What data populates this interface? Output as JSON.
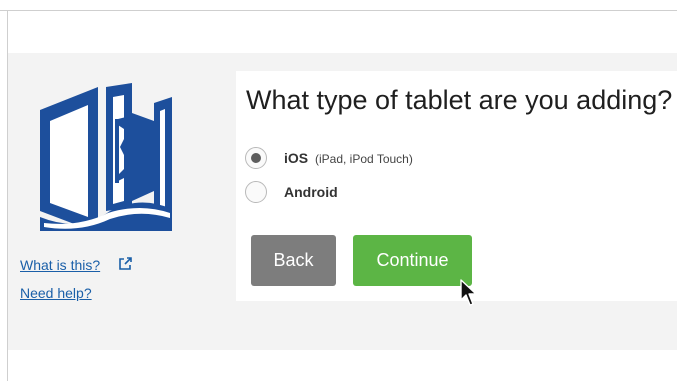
{
  "sidebar": {
    "logo_icon": "open-book-b-logo",
    "what_is_this": "What is this?",
    "need_help": "Need help?",
    "external_icon": "external-link-icon"
  },
  "card": {
    "question": "What type of tablet are you adding?",
    "options": [
      {
        "label": "iOS",
        "detail": "(iPad, iPod Touch)",
        "selected": true
      },
      {
        "label": "Android",
        "detail": "",
        "selected": false
      }
    ],
    "back_label": "Back",
    "continue_label": "Continue"
  },
  "colors": {
    "brand_blue": "#1d4f9c",
    "link_blue": "#1a5fa8",
    "continue_green": "#5cb545",
    "back_gray": "#7d7d7d"
  }
}
